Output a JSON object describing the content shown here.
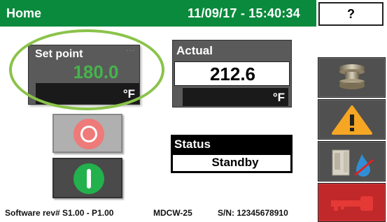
{
  "header": {
    "title": "Home",
    "datetime": "11/09/17 - 15:40:34",
    "help_label": "?"
  },
  "set_point": {
    "label": "Set point",
    "value": "180.0",
    "unit": "°F"
  },
  "actual": {
    "label": "Actual",
    "value": "212.6",
    "unit": "°F"
  },
  "status": {
    "label": "Status",
    "value": "Standby"
  },
  "controls": {
    "stop_icon": "stop-icon",
    "start_icon": "start-icon"
  },
  "side_buttons": [
    {
      "icon": "spool-icon"
    },
    {
      "icon": "warning-icon"
    },
    {
      "icon": "water-cooler-icon"
    },
    {
      "icon": "key-icon"
    }
  ],
  "footer": {
    "software": "Software rev# S1.00 - P1.00",
    "model": "MDCW-25",
    "serial": "S/N: 12345678910"
  },
  "colors": {
    "header_green": "#0a8a3c",
    "setpoint_green": "#47b34d",
    "highlight": "#8bc34a",
    "warning_orange": "#f5a623",
    "key_red": "#c0282a"
  }
}
